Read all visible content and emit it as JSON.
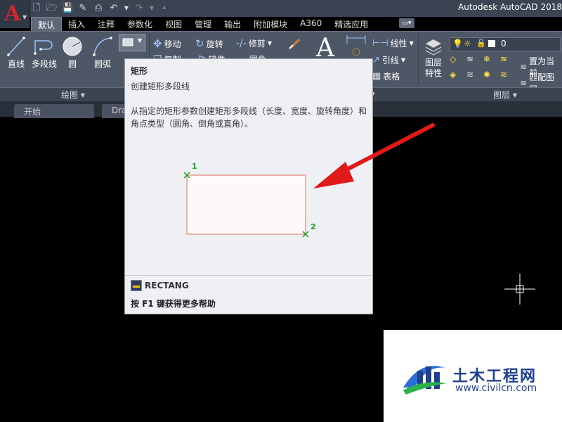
{
  "app": {
    "title": "Autodesk AutoCAD 2018",
    "logo_letter": "A"
  },
  "ribbon_tabs": [
    {
      "label": "默认",
      "active": true
    },
    {
      "label": "插入"
    },
    {
      "label": "注释"
    },
    {
      "label": "参数化"
    },
    {
      "label": "视图"
    },
    {
      "label": "管理"
    },
    {
      "label": "输出"
    },
    {
      "label": "附加模块"
    },
    {
      "label": "A360"
    },
    {
      "label": "精选应用"
    }
  ],
  "draw_panel": {
    "title": "绘图",
    "tools": [
      "直线",
      "多段线",
      "圆",
      "圆弧"
    ]
  },
  "modify_panel": {
    "row1": [
      "移动",
      "旋转",
      "修剪"
    ],
    "row2_partial": [
      "复制",
      "镜像",
      "圆角"
    ]
  },
  "annotation_panel": {
    "items": [
      "线性",
      "引线",
      "表格"
    ]
  },
  "layers_panel": {
    "title": "图层",
    "properties_label": [
      "图层",
      "特性"
    ],
    "layer_value": "0",
    "buttons": [
      "置为当前",
      "匹配图层"
    ]
  },
  "doc_tabs": [
    "开始",
    "Dra"
  ],
  "tooltip": {
    "title": "矩形",
    "subtitle": "创建矩形多段线",
    "description": "从指定的矩形参数创建矩形多段线（长度、宽度、旋转角度）和角点类型（圆角、倒角或直角）。",
    "point_labels": [
      "1",
      "2"
    ],
    "command": "RECTANG",
    "help": "按 F1 键获得更多帮助"
  },
  "watermark": {
    "name": "土木工程网",
    "url": "www.civilcn.com"
  },
  "colors": {
    "arrow": "#e01a1a",
    "rect_stroke": "#e07060",
    "point_marker": "#1aa01a",
    "ribbon_bg": "#4e5766"
  }
}
